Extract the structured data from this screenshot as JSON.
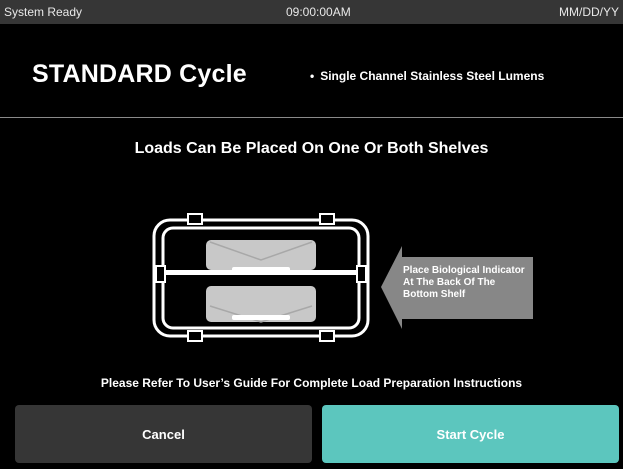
{
  "status_bar": {
    "status": "System Ready",
    "time": "09:00:00AM",
    "date": "MM/DD/YY"
  },
  "header": {
    "cycle_title": "STANDARD Cycle",
    "bullet": "•",
    "cycle_subtitle": "Single Channel Stainless Steel Lumens"
  },
  "main": {
    "headline": "Loads Can Be Placed On One Or Both Shelves",
    "callout": "Place Biological Indicator At The Back Of The Bottom Shelf",
    "footer_note": "Please Refer To User’s Guide For Complete Load Preparation Instructions"
  },
  "buttons": {
    "cancel": "Cancel",
    "start": "Start Cycle"
  },
  "colors": {
    "background": "#000000",
    "status_bar": "#363636",
    "cancel_button": "#363636",
    "start_button": "#5cc6be",
    "callout": "#878787",
    "tray": "#c8c8c8"
  },
  "icons": {
    "chamber": "chamber-shelves-icon",
    "pointer": "arrow-left-callout"
  }
}
